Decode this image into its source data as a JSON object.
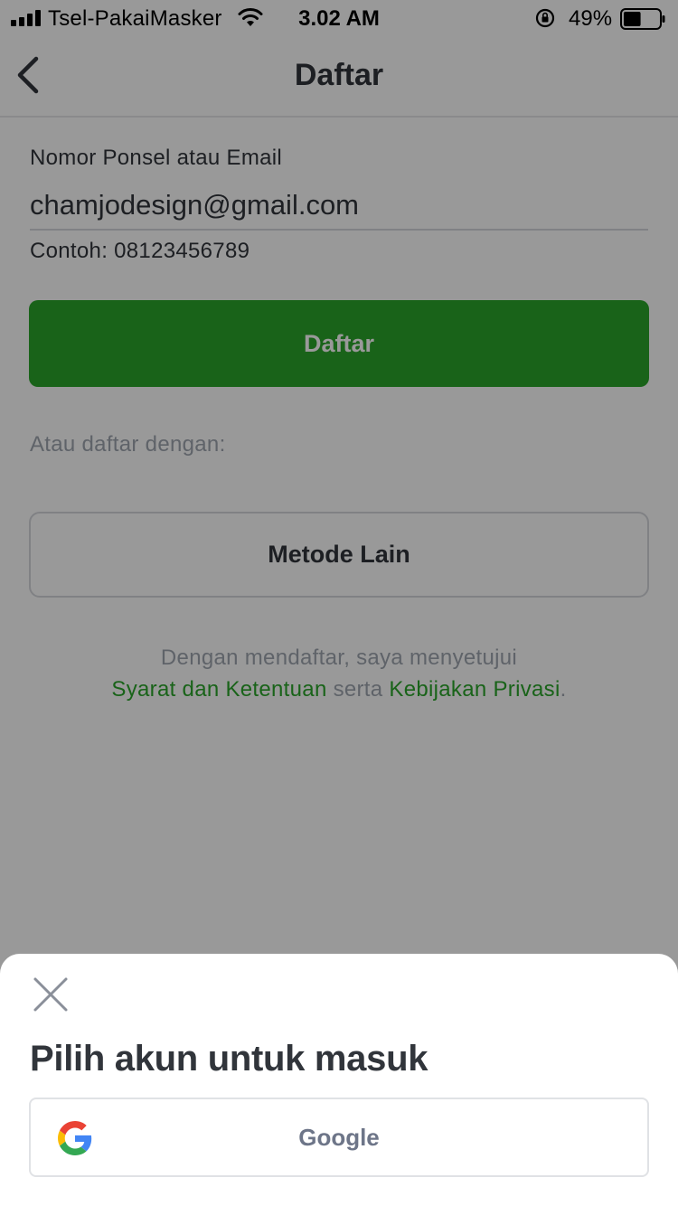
{
  "status_bar": {
    "carrier": "Tsel-PakaiMasker",
    "time": "3.02 AM",
    "battery_percent": "49%",
    "battery_level": 0.49,
    "icons": [
      "signal-icon",
      "wifi-icon",
      "rotation-lock-icon",
      "battery-icon"
    ]
  },
  "header": {
    "title": "Daftar",
    "back_icon": "chevron-left-icon"
  },
  "form": {
    "field_label": "Nomor Ponsel atau Email",
    "field_value": "chamjodesign@gmail.com",
    "hint": "Contoh: 08123456789",
    "submit_label": "Daftar"
  },
  "alternatives": {
    "label": "Atau daftar dengan:",
    "other_methods_label": "Metode Lain"
  },
  "terms": {
    "line1": "Dengan mendaftar, saya menyetujui",
    "terms_link": "Syarat dan Ketentuan",
    "connector": "serta",
    "privacy_link": "Kebijakan Privasi",
    "end": "."
  },
  "sheet": {
    "title": "Pilih akun untuk masuk",
    "close_icon": "close-icon",
    "providers": [
      {
        "label": "Google",
        "icon": "google-logo-icon"
      }
    ]
  },
  "colors": {
    "accent_green": "#2aa52a",
    "text_dark": "#31353b",
    "text_muted": "#9fa6b0",
    "overlay": "rgba(0,0,0,0.4)"
  }
}
